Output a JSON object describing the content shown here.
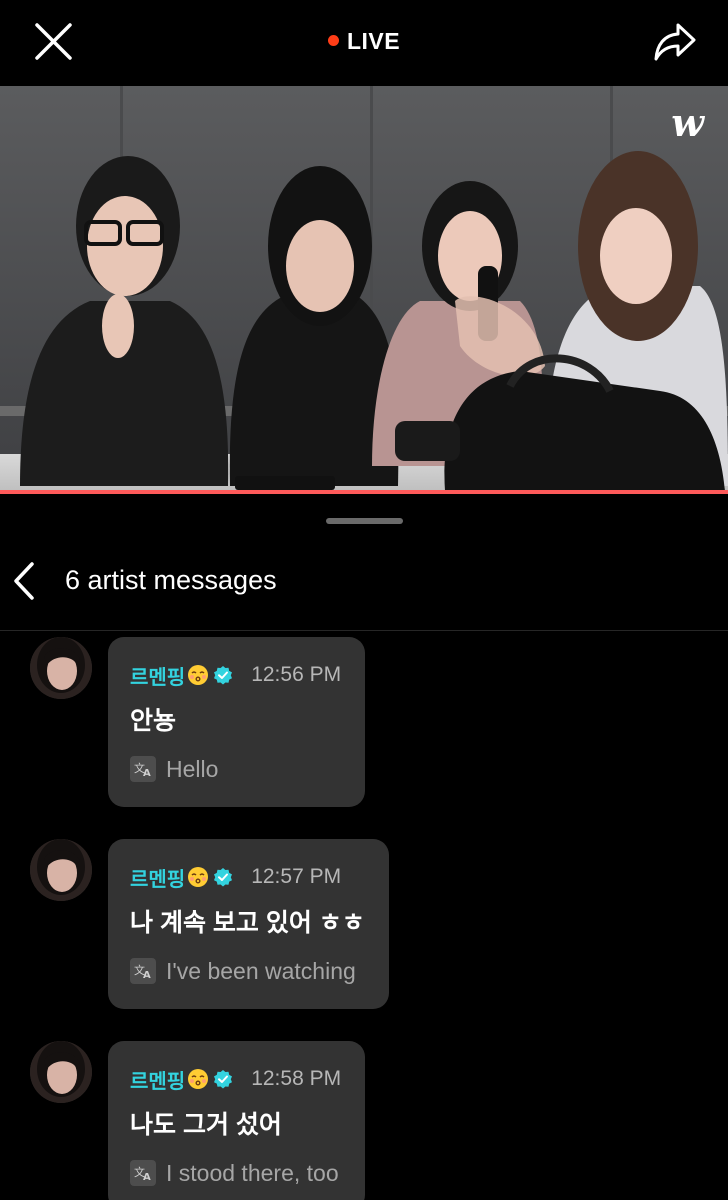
{
  "header": {
    "live_label": "LIVE",
    "close_icon": "close-icon",
    "share_icon": "share-icon"
  },
  "video": {
    "logo_text": "w",
    "progress": 1.0
  },
  "sheet": {
    "title": "6 artist messages",
    "back_icon": "chevron-left-icon"
  },
  "messages": [
    {
      "author": "르멘핑",
      "time": "12:56 PM",
      "text": "안뇽",
      "translation": "Hello"
    },
    {
      "author": "르멘핑",
      "time": "12:57 PM",
      "text": "나 계속 보고 있어 ㅎㅎ",
      "translation": "I've been watching"
    },
    {
      "author": "르멘핑",
      "time": "12:58 PM",
      "text": "나도 그거 섰어",
      "translation": "I stood there, too"
    }
  ],
  "colors": {
    "accent_name": "#33d3df",
    "live_dot": "#ff3d17",
    "bubble": "#333333",
    "progress": "#ff5a5a"
  }
}
